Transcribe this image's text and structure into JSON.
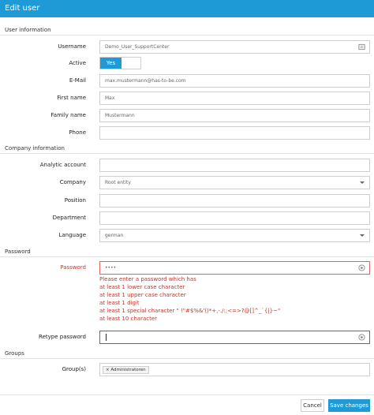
{
  "window": {
    "title": "Edit user"
  },
  "sections": {
    "user_information": "User information",
    "company_information": "Company information",
    "password": "Password",
    "groups": "Groups"
  },
  "user": {
    "username_label": "Username",
    "username_value": "Demo_User_SupportCenter",
    "active_label": "Active",
    "active_value": "Yes",
    "email_label": "E-Mail",
    "email_value": "max.mustermann@has-to-be.com",
    "first_name_label": "First name",
    "first_name_value": "Max",
    "family_name_label": "Family name",
    "family_name_value": "Mustermann",
    "phone_label": "Phone",
    "phone_value": ""
  },
  "company": {
    "analytic_account_label": "Analytic account",
    "analytic_account_value": "",
    "company_label": "Company",
    "company_value": "Root entity",
    "position_label": "Position",
    "position_value": "",
    "department_label": "Department",
    "department_value": "",
    "language_label": "Language",
    "language_value": "german"
  },
  "password": {
    "password_label": "Password",
    "password_value": "••••",
    "errors": [
      "Please enter a password which has",
      "at least 1 lower case character",
      "at least 1 upper case character",
      "at least 1 digit",
      "at least 1 special character \" !\"#$%&'()*+,-./:;<=>?@[]^_`{|}~\"",
      "at least 10 character"
    ],
    "retype_label": "Retype password",
    "retype_value": ""
  },
  "groups": {
    "label": "Group(s)",
    "tag": "× Administratoren"
  },
  "footer": {
    "cancel": "Cancel",
    "save": "Save changes"
  },
  "colors": {
    "accent": "#1e9ad6",
    "error": "#c0392b"
  },
  "icons": {
    "username_field": "id-card-icon",
    "password_field": "eye-icon",
    "retype_field": "eye-icon"
  }
}
